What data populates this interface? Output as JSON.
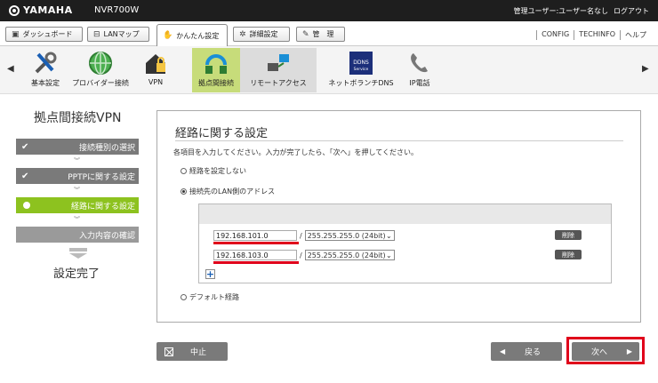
{
  "topbar": {
    "logo": "YAMAHA",
    "model": "NVR700W",
    "user": "管理ユーザー:ユーザー名なし",
    "logout": "ログアウト"
  },
  "mainnav": {
    "dashboard": "ダッシュボード",
    "lanmap": "LANマップ",
    "easy": "かんたん設定",
    "detail": "詳細設定",
    "admin": "管　理",
    "links": [
      "CONFIG",
      "TECHINFO",
      "ヘルプ"
    ]
  },
  "iconmenu": [
    {
      "label": "基本設定"
    },
    {
      "label": "プロバイダー接続"
    },
    {
      "label": "VPN"
    },
    {
      "label": "拠点間接続"
    },
    {
      "label": "リモートアクセス"
    },
    {
      "label": "ネットボランチDNS"
    },
    {
      "label": "IP電話"
    }
  ],
  "sidebar": {
    "title": "拠点間接続VPN",
    "steps": [
      {
        "label": "接続種別の選択",
        "state": "done"
      },
      {
        "label": "PPTPに関する設定",
        "state": "done"
      },
      {
        "label": "経路に関する設定",
        "state": "current"
      },
      {
        "label": "入力内容の確認",
        "state": "future"
      }
    ],
    "done_label": "設定完了"
  },
  "panel": {
    "title": "経路に関する設定",
    "instruction": "各項目を入力してください。入力が完了したら、「次へ」を押してください。",
    "options": [
      {
        "label": "経路を設定しない",
        "selected": false
      },
      {
        "label": "接続先のLAN側のアドレス",
        "selected": true
      },
      {
        "label": "デフォルト経路",
        "selected": false
      }
    ],
    "routes": [
      {
        "ip": "192.168.101.0",
        "mask": "255.255.255.0 (24bit)",
        "delete": "削除"
      },
      {
        "ip": "192.168.103.0",
        "mask": "255.255.255.0 (24bit)",
        "delete": "削除"
      }
    ],
    "add_symbol": "+"
  },
  "buttons": {
    "cancel": "中止",
    "back": "戻る",
    "next": "次へ"
  },
  "colors": {
    "accent_green": "#8dc21f",
    "highlight_red": "#e0001b",
    "step_gray": "#7a7a7a"
  }
}
